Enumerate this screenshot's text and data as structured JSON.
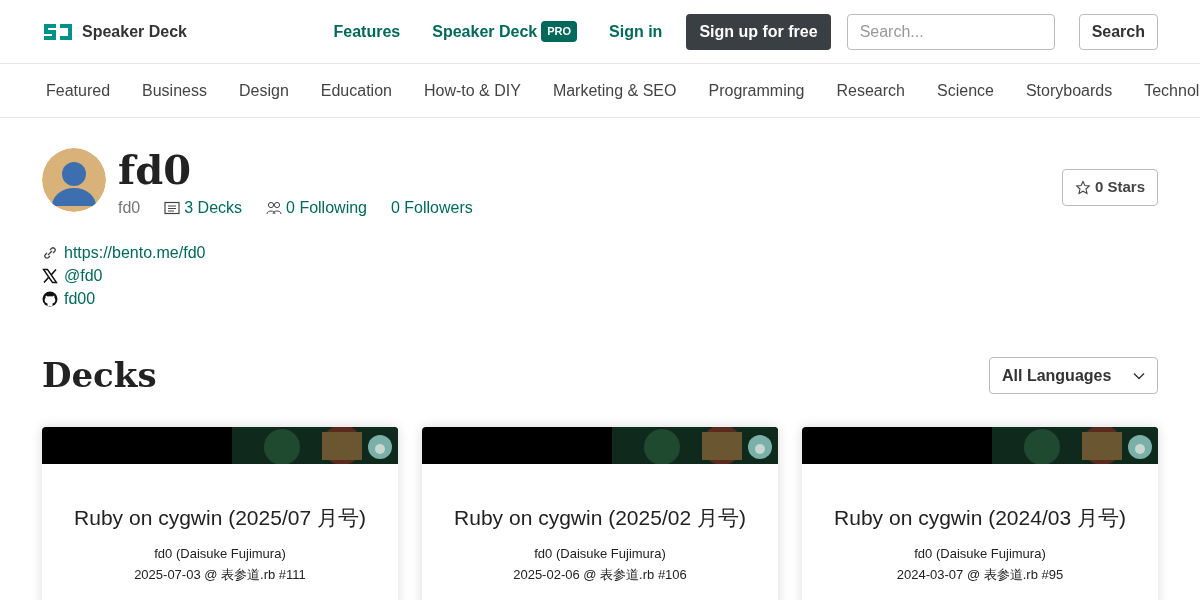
{
  "header": {
    "logo": "Speaker Deck",
    "nav": [
      "Features",
      "Speaker Deck"
    ],
    "pro_badge": "PRO",
    "sign_in": "Sign in",
    "signup": "Sign up for free",
    "search": {
      "placeholder": "Search..."
    },
    "search_button": "Search"
  },
  "categories": [
    "Featured",
    "Business",
    "Design",
    "Education",
    "How-to & DIY",
    "Marketing & SEO",
    "Programming",
    "Research",
    "Science",
    "Storyboards",
    "Technol"
  ],
  "profile": {
    "name": "fd0",
    "username": "fd0",
    "decks": "3 Decks",
    "following": "0 Following",
    "followers": "0 Followers",
    "stars": "0 Stars",
    "links": [
      {
        "kind": "link",
        "text": "https://bento.me/fd0"
      },
      {
        "kind": "x",
        "text": "@fd0"
      },
      {
        "kind": "github",
        "text": "fd00"
      }
    ]
  },
  "decks_heading": "Decks",
  "language_select": "All Languages",
  "decks": [
    {
      "title": "Ruby on cygwin (2025/07 月号)",
      "author": "fd0 (Daisuke Fujimura)",
      "event": "2025-07-03 @ 表参道.rb #111"
    },
    {
      "title": "Ruby on cygwin (2025/02 月号)",
      "author": "fd0 (Daisuke Fujimura)",
      "event": "2025-02-06 @ 表参道.rb #106"
    },
    {
      "title": "Ruby on cygwin (2024/03 月号)",
      "author": "fd0 (Daisuke Fujimura)",
      "event": "2024-03-07 @ 表参道.rb #95"
    }
  ]
}
